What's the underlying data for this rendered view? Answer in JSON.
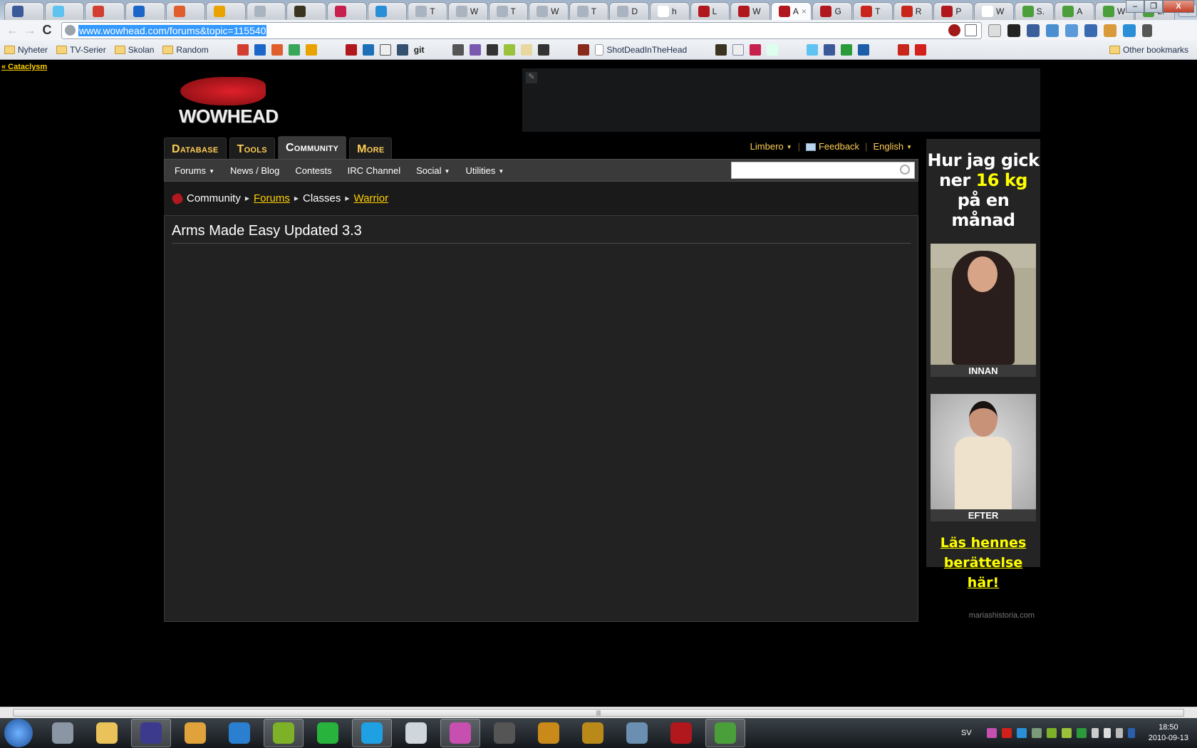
{
  "browser": {
    "tabs": [
      {
        "title": "",
        "color": "#3b5998"
      },
      {
        "title": "",
        "color": "#5ec3f0"
      },
      {
        "title": "",
        "color": "#d23f31"
      },
      {
        "title": "",
        "color": "#1c66c9"
      },
      {
        "title": "",
        "color": "#e05d2e"
      },
      {
        "title": "",
        "color": "#e8a300"
      },
      {
        "title": "",
        "color": "#aab4c0"
      },
      {
        "title": "",
        "color": "#3a3320"
      },
      {
        "title": "",
        "color": "#c7204f"
      },
      {
        "title": "",
        "color": "#2a8fd6"
      },
      {
        "title": "T",
        "color": "#aab4c0"
      },
      {
        "title": "W",
        "color": "#aab4c0"
      },
      {
        "title": "T",
        "color": "#aab4c0"
      },
      {
        "title": "W",
        "color": "#aab4c0"
      },
      {
        "title": "T",
        "color": "#aab4c0"
      },
      {
        "title": "D",
        "color": "#aab4c0"
      },
      {
        "title": "h",
        "color": "#ffffff"
      },
      {
        "title": "L",
        "color": "#b0181e"
      },
      {
        "title": "W",
        "color": "#b0181e"
      },
      {
        "title": "A",
        "color": "#b0181e",
        "active": true
      },
      {
        "title": "G",
        "color": "#b0181e"
      },
      {
        "title": "T",
        "color": "#c8261b"
      },
      {
        "title": "R",
        "color": "#c8261b"
      },
      {
        "title": "P",
        "color": "#b0181e"
      },
      {
        "title": "W",
        "color": "#ffffff"
      },
      {
        "title": "S.",
        "color": "#4a9f3a"
      },
      {
        "title": "A",
        "color": "#4a9f3a"
      },
      {
        "title": "W",
        "color": "#4a9f3a"
      },
      {
        "title": "L.",
        "color": "#4a9f3a"
      }
    ],
    "tab_close": "×",
    "new_tab": "+",
    "window_controls": {
      "minimize": "–",
      "maximize": "❐",
      "close": "X"
    },
    "nav": {
      "back": "←",
      "forward": "→",
      "reload": "C"
    },
    "url": "www.wowhead.com/forums&topic=115540",
    "bookmarks": {
      "folders": [
        "Nyheter",
        "TV-Serier",
        "Skolan",
        "Random"
      ],
      "link": "ShotDeadInTheHead",
      "git": "git",
      "other": "Other bookmarks"
    }
  },
  "page": {
    "back_link": "« Cataclysm",
    "logo_text": "WOWHEAD",
    "main_tabs": [
      "Database",
      "Tools",
      "Community",
      "More"
    ],
    "active_tab": "Community",
    "user_links": {
      "user": "Limbero",
      "feedback": "Feedback",
      "language": "English"
    },
    "subnav": [
      "Forums",
      "News / Blog",
      "Contests",
      "IRC Channel",
      "Social",
      "Utilities"
    ],
    "search_placeholder": "",
    "breadcrumb": [
      "Community",
      "Forums",
      "Classes",
      "Warrior"
    ],
    "topic_title": "Arms Made Easy Updated 3.3",
    "ad": {
      "line1": "Hur jag gick",
      "line2a": "ner ",
      "line2b": "16 kg",
      "line3": "på en månad",
      "before": "INNAN",
      "after": "EFTER",
      "cta1": "Läs hennes",
      "cta2": "berättelse här!",
      "source": "mariashistoria.com"
    }
  },
  "taskbar": {
    "apps": [
      {
        "name": "recycle-bin",
        "color": "#8a96a4"
      },
      {
        "name": "explorer",
        "color": "#e9c25a"
      },
      {
        "name": "eclipse",
        "color": "#3b3a8c",
        "active": true
      },
      {
        "name": "tortoise",
        "color": "#e0a23a"
      },
      {
        "name": "itunes",
        "color": "#2b7fd0"
      },
      {
        "name": "spotify",
        "color": "#7db127",
        "active": true
      },
      {
        "name": "arrow",
        "color": "#27b33c"
      },
      {
        "name": "skype",
        "color": "#1fa0e3",
        "active": true
      },
      {
        "name": "headset",
        "color": "#cfd6dc"
      },
      {
        "name": "winamp-like",
        "color": "#c64fb0",
        "active": true
      },
      {
        "name": "steam",
        "color": "#555"
      },
      {
        "name": "guild-wars-2",
        "color": "#c98a1a"
      },
      {
        "name": "world-of-warcraft",
        "color": "#b98a1a"
      },
      {
        "name": "starcraft",
        "color": "#6a8fb0"
      },
      {
        "name": "wowhead",
        "color": "#b0181e"
      },
      {
        "name": "chrome",
        "color": "#4a9f3a",
        "active": true
      }
    ],
    "language": "SV",
    "time": "18:50",
    "date": "2010-09-13"
  }
}
